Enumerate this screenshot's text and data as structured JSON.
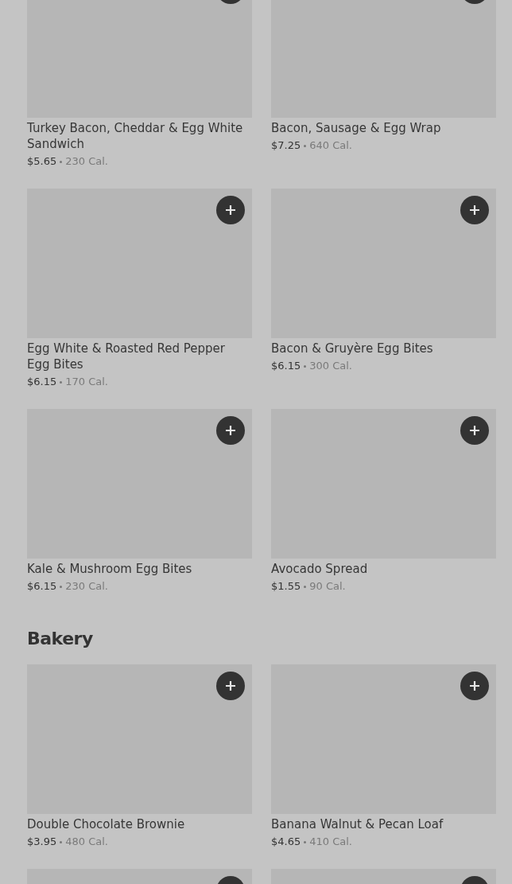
{
  "sections": [
    {
      "items": [
        {
          "kind": "item",
          "name": "Turkey Bacon, Cheddar & Egg White Sandwich",
          "price": "$5.65",
          "calories": "230 Cal."
        },
        {
          "kind": "item",
          "name": "Bacon, Sausage & Egg Wrap",
          "price": "$7.25",
          "calories": "640 Cal."
        },
        {
          "kind": "item",
          "name": "Egg White & Roasted Red Pepper Egg Bites",
          "price": "$6.15",
          "calories": "170 Cal."
        },
        {
          "kind": "item",
          "name": "Bacon & Gruyère Egg Bites",
          "price": "$6.15",
          "calories": "300 Cal."
        },
        {
          "kind": "item",
          "name": "Kale & Mushroom Egg Bites",
          "price": "$6.15",
          "calories": "230 Cal."
        },
        {
          "kind": "item",
          "name": "Avocado Spread",
          "price": "$1.55",
          "calories": "90 Cal."
        }
      ]
    },
    {
      "heading": "Bakery",
      "items": [
        {
          "kind": "item",
          "name": "Double Chocolate Brownie",
          "price": "$3.95",
          "calories": "480 Cal."
        },
        {
          "kind": "item",
          "name": "Banana Walnut & Pecan Loaf",
          "price": "$4.65",
          "calories": "410 Cal."
        },
        {
          "kind": "cut"
        },
        {
          "kind": "cut"
        }
      ]
    }
  ]
}
